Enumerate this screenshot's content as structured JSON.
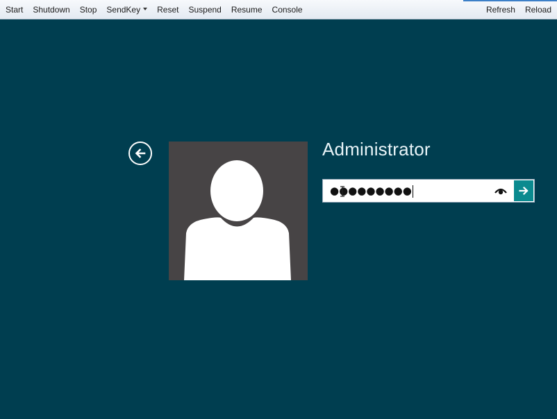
{
  "toolbar": {
    "left_items": [
      "Start",
      "Shutdown",
      "Stop",
      "SendKey",
      "Reset",
      "Suspend",
      "Resume",
      "Console"
    ],
    "right_items": [
      "Refresh",
      "Reload"
    ],
    "sendkey_icon": "chevron-down-icon"
  },
  "login": {
    "username": "Administrator",
    "password_masked": "●●●●●●●●●",
    "back_icon": "arrow-left-circle-icon",
    "reveal_icon": "eye-icon",
    "submit_icon": "arrow-right-icon",
    "avatar_icon": "user-silhouette-icon"
  },
  "colors": {
    "background": "#003e50",
    "avatar_bg": "#474445",
    "submit_bg": "#0a8a8f",
    "toolbar_bg": "#eef2f7"
  }
}
